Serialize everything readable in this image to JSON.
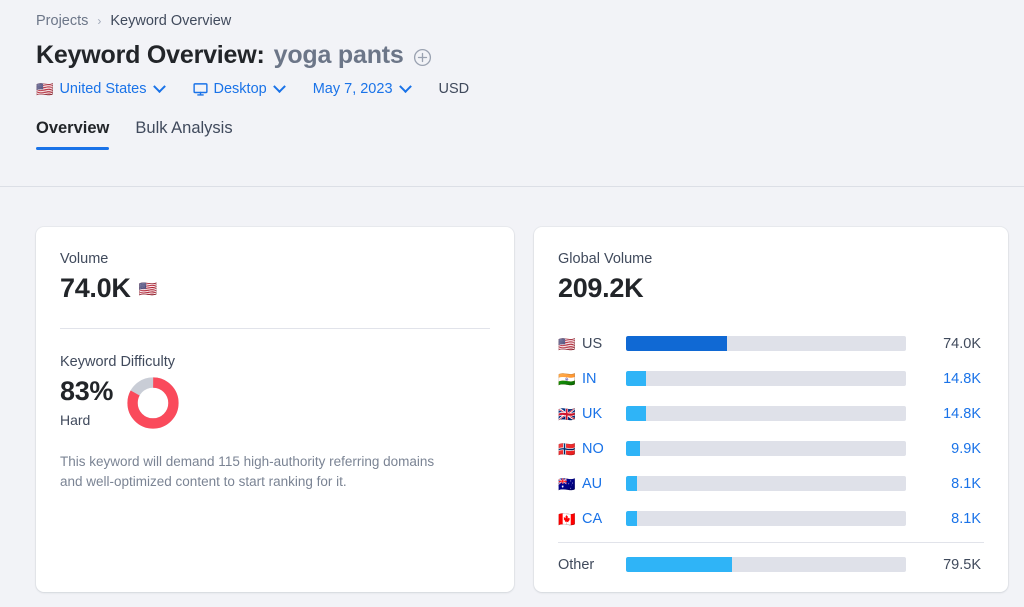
{
  "breadcrumb": {
    "parent": "Projects",
    "separator": "›",
    "current": "Keyword Overview"
  },
  "title": {
    "prefix": "Keyword Overview:",
    "keyword": "yoga pants",
    "add_icon": "plus-circle-icon"
  },
  "filters": {
    "country": {
      "flag": "🇺🇸",
      "label": "United States",
      "caret": "chevron-down-icon"
    },
    "device": {
      "icon": "monitor-icon",
      "label": "Desktop",
      "caret": "chevron-down-icon"
    },
    "date": {
      "label": "May 7, 2023",
      "caret": "chevron-down-icon"
    },
    "currency": "USD"
  },
  "tabs": [
    {
      "label": "Overview",
      "active": true
    },
    {
      "label": "Bulk Analysis",
      "active": false
    }
  ],
  "volume_card": {
    "volume_label": "Volume",
    "volume_value": "74.0K",
    "volume_flag": "🇺🇸",
    "kd_label": "Keyword Difficulty",
    "kd_value": "83%",
    "kd_word": "Hard",
    "kd_percent": 83,
    "kd_color": "#fa4a5b",
    "kd_track_color": "#c9cdd6",
    "kd_description": "This keyword will demand 115 high-authority referring domains and well-optimized content to start ranking for it."
  },
  "global_card": {
    "title": "Global Volume",
    "value": "209.2K",
    "rows": [
      {
        "flag": "🇺🇸",
        "code": "US",
        "value": "74.0K",
        "percent": 36,
        "primary": true
      },
      {
        "flag": "🇮🇳",
        "code": "IN",
        "value": "14.8K",
        "percent": 7,
        "primary": false
      },
      {
        "flag": "🇬🇧",
        "code": "UK",
        "value": "14.8K",
        "percent": 7,
        "primary": false
      },
      {
        "flag": "🇳🇴",
        "code": "NO",
        "value": "9.9K",
        "percent": 5,
        "primary": false
      },
      {
        "flag": "🇦🇺",
        "code": "AU",
        "value": "8.1K",
        "percent": 4,
        "primary": false
      },
      {
        "flag": "🇨🇦",
        "code": "CA",
        "value": "8.1K",
        "percent": 4,
        "primary": false
      }
    ],
    "other_row": {
      "code": "Other",
      "value": "79.5K",
      "percent": 38
    }
  },
  "colors": {
    "page_bg": "#f2f3f7",
    "card_bg": "#ffffff",
    "link_blue": "#1a73e8",
    "bar_primary": "#1069d4",
    "bar_secondary": "#2fb4f7",
    "bar_track": "#dfe1e9",
    "text_dark": "#222529",
    "text_muted": "#6c7688",
    "kd_red": "#fa4a5b"
  }
}
